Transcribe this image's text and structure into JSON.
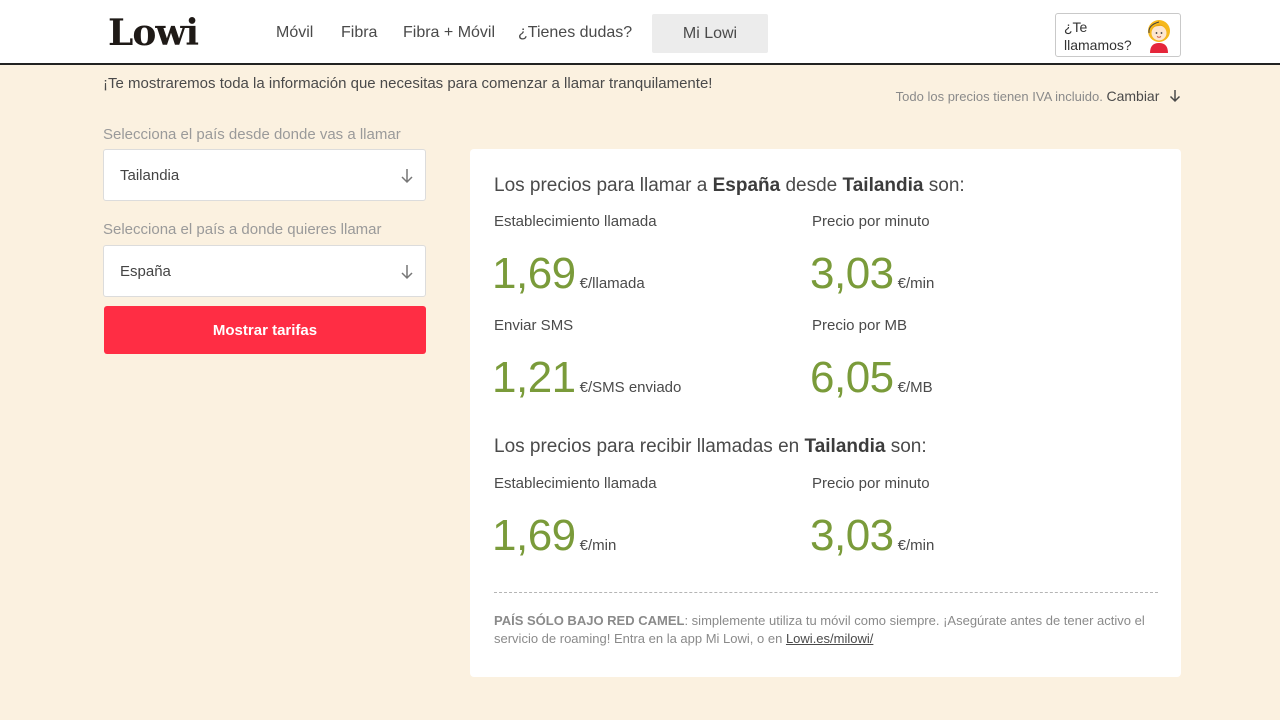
{
  "header": {
    "logo": "Lowi",
    "nav": [
      {
        "label": "Móvil"
      },
      {
        "label": "Fibra"
      },
      {
        "label": "Fibra + Móvil"
      },
      {
        "label": "¿Tienes dudas?"
      }
    ],
    "mi_lowi": "Mi Lowi",
    "call_me": "¿Te llamamos?"
  },
  "intro": "¡Te mostraremos toda la información que necesitas para comenzar a llamar tranquilamente!",
  "iva": {
    "text": "Todo los precios tienen IVA incluido.",
    "change": "Cambiar"
  },
  "form": {
    "from_label": "Selecciona el país desde donde vas a llamar",
    "from_value": "Tailandia",
    "to_label": "Selecciona el país a donde quieres llamar",
    "to_value": "España",
    "submit": "Mostrar tarifas"
  },
  "results": {
    "call_title": {
      "pre": "Los precios para llamar a",
      "dest": "España",
      "mid": "desde",
      "origin": "Tailandia",
      "post": "son:"
    },
    "call": {
      "setup_label": "Establecimiento llamada",
      "setup_value": "1,69",
      "setup_unit": "€/llamada",
      "minute_label": "Precio por minuto",
      "minute_value": "3,03",
      "minute_unit": "€/min",
      "sms_label": "Enviar SMS",
      "sms_value": "1,21",
      "sms_unit": "€/SMS enviado",
      "mb_label": "Precio por MB",
      "mb_value": "6,05",
      "mb_unit": "€/MB"
    },
    "receive_title": {
      "pre": "Los precios para recibir llamadas en",
      "country": "Tailandia",
      "post": "son:"
    },
    "receive": {
      "setup_label": "Establecimiento llamada",
      "setup_value": "1,69",
      "setup_unit": "€/min",
      "minute_label": "Precio por minuto",
      "minute_value": "3,03",
      "minute_unit": "€/min"
    },
    "note": {
      "bold": "PAÍS SÓLO BAJO RED CAMEL",
      "text": ": simplemente utiliza tu móvil como siempre. ¡Asegúrate antes de tener activo el servicio de roaming! Entra en la app Mi Lowi, o en",
      "link": "Lowi.es/milowi/"
    }
  },
  "colors": {
    "accent": "#ff2d44",
    "price": "#7a9b3a",
    "background": "#fbf1e0"
  },
  "icons": [
    "chevron-down-icon",
    "arrow-down-icon",
    "agent-avatar-icon"
  ]
}
